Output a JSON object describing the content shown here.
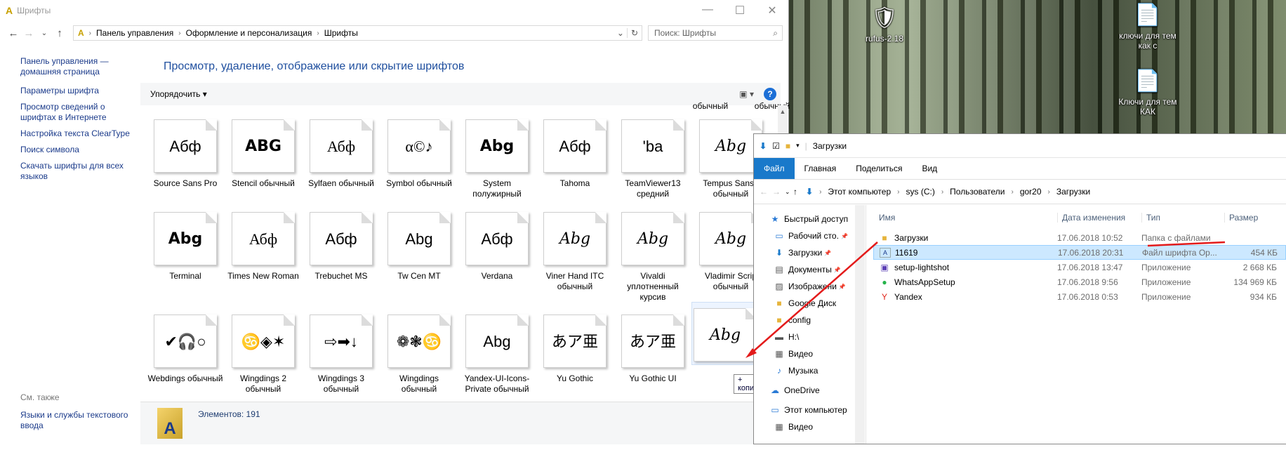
{
  "desktop": {
    "icons": [
      {
        "label": "rufus-2.18",
        "icon": "usb-icon"
      },
      {
        "label": "ключи для тем как с",
        "icon": "excel-file-icon"
      },
      {
        "label": "Ключи для тем КАК",
        "icon": "excel-file-icon"
      }
    ]
  },
  "fonts_window": {
    "title": "Шрифты",
    "breadcrumb": [
      "Панель управления",
      "Оформление и персонализация",
      "Шрифты"
    ],
    "search_placeholder": "Поиск: Шрифты",
    "left_links": [
      "Панель управления — домашняя страница",
      "Параметры шрифта",
      "Просмотр сведений о шрифтах в Интернете",
      "Настройка текста ClearType",
      "Поиск символа",
      "Скачать шрифты для всех языков"
    ],
    "see_also": "См. также",
    "see_also_link": "Языки и службы текстового ввода",
    "heading": "Просмотр, удаление, отображение или скрытие шрифтов",
    "organize": "Упорядочить",
    "partial_labels": [
      "обычный",
      "обычный"
    ],
    "tiles": [
      {
        "preview": "Абф",
        "label": "Source Sans Pro"
      },
      {
        "preview": "ABG",
        "label": "Stencil обычный"
      },
      {
        "preview": "Абф",
        "label": "Sylfaen обычный"
      },
      {
        "preview": "α©♪",
        "label": "Symbol обычный"
      },
      {
        "preview": "Abg",
        "label": "System полужирный"
      },
      {
        "preview": "Абф",
        "label": "Tahoma"
      },
      {
        "preview": "'ba",
        "label": "TeamViewer13 средний"
      },
      {
        "preview": "Abg",
        "label": "Tempus Sans I обычный"
      },
      {
        "preview": "Abg",
        "label": "Terminal"
      },
      {
        "preview": "Абф",
        "label": "Times New Roman"
      },
      {
        "preview": "Абф",
        "label": "Trebuchet MS"
      },
      {
        "preview": "Abg",
        "label": "Tw Cen MT"
      },
      {
        "preview": "Абф",
        "label": "Verdana"
      },
      {
        "preview": "Abg",
        "label": "Viner Hand ITC обычный"
      },
      {
        "preview": "Abg",
        "label": "Vivaldi уплотненный курсив"
      },
      {
        "preview": "Abg",
        "label": "Vladimir Scrip обычный"
      },
      {
        "preview": "✔🎧○",
        "label": "Webdings обычный"
      },
      {
        "preview": "♋◈✶",
        "label": "Wingdings 2 обычный"
      },
      {
        "preview": "⇨➡↓",
        "label": "Wingdings 3 обычный"
      },
      {
        "preview": "❁❃♋",
        "label": "Wingdings обычный"
      },
      {
        "preview": "Abg",
        "label": "Yandex-UI-Icons-Private обычный"
      },
      {
        "preview": "あア亜",
        "label": "Yu Gothic"
      },
      {
        "preview": "あア亜",
        "label": "Yu Gothic UI"
      }
    ],
    "drag_preview": "Abg",
    "copy_tooltip": "+ копирование",
    "status_count": "Элементов: 191"
  },
  "explorer": {
    "title": "Загрузки",
    "tabs": [
      "Файл",
      "Главная",
      "Поделиться",
      "Вид"
    ],
    "breadcrumb": [
      "Этот компьютер",
      "sys (C:)",
      "Пользователи",
      "gor20",
      "Загрузки"
    ],
    "nav": [
      {
        "label": "Быстрый доступ",
        "icon": "star-icon"
      },
      {
        "label": "Рабочий сто.",
        "icon": "desktop-icon"
      },
      {
        "label": "Загрузки",
        "icon": "download-icon"
      },
      {
        "label": "Документы",
        "icon": "documents-icon"
      },
      {
        "label": "Изображени",
        "icon": "pictures-icon"
      },
      {
        "label": "Google Диск",
        "icon": "folder-icon"
      },
      {
        "label": "config",
        "icon": "folder-icon"
      },
      {
        "label": "H:\\",
        "icon": "drive-icon"
      },
      {
        "label": "Видео",
        "icon": "video-icon"
      },
      {
        "label": "Музыка",
        "icon": "music-icon"
      },
      {
        "label": "OneDrive",
        "icon": "cloud-icon"
      },
      {
        "label": "Этот компьютер",
        "icon": "computer-icon"
      },
      {
        "label": "Видео",
        "icon": "video-icon"
      }
    ],
    "columns": [
      "Имя",
      "Дата изменения",
      "Тип",
      "Размер"
    ],
    "files": [
      {
        "name": "Загрузки",
        "date": "17.06.2018 10:52",
        "type": "Папка с файлами",
        "size": "",
        "icon": "folder-icon"
      },
      {
        "name": "11619",
        "date": "17.06.2018 20:31",
        "type": "Файл шрифта Op...",
        "size": "454 КБ",
        "icon": "font-file-icon"
      },
      {
        "name": "setup-lightshot",
        "date": "17.06.2018 13:47",
        "type": "Приложение",
        "size": "2 668 КБ",
        "icon": "app-icon"
      },
      {
        "name": "WhatsAppSetup",
        "date": "17.06.2018 9:56",
        "type": "Приложение",
        "size": "134 969 КБ",
        "icon": "whatsapp-icon"
      },
      {
        "name": "Yandex",
        "date": "17.06.2018 0:53",
        "type": "Приложение",
        "size": "934 КБ",
        "icon": "yandex-icon"
      }
    ]
  },
  "colors": {
    "link": "#1a3a8a",
    "accent": "#1979ca",
    "arrow": "#e31b1b"
  }
}
